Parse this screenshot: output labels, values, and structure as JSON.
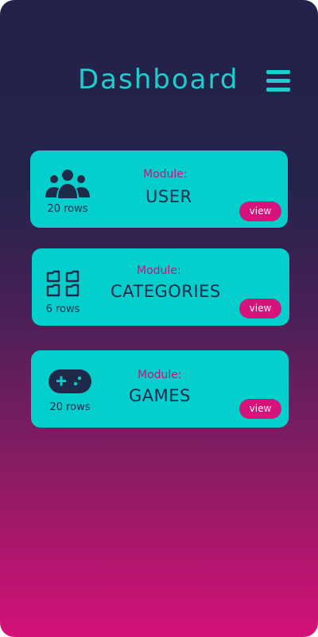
{
  "header": {
    "title": "Dashboard",
    "menu_icon": "hamburger-menu-icon"
  },
  "colors": {
    "title": "#1ccfcf",
    "card_background": "#05cfcd",
    "module_label": "#c2167d",
    "module_name": "#1f2a4a",
    "view_button": "#d7127a",
    "background_top": "#22224a",
    "background_bottom": "#d41178"
  },
  "cards": [
    {
      "icon": "users-icon",
      "rows": "20 rows",
      "label": "Module:",
      "name": "USER",
      "button": "view"
    },
    {
      "icon": "categories-icon",
      "rows": "6 rows",
      "label": "Module:",
      "name": "CATEGORIES",
      "button": "view"
    },
    {
      "icon": "gamepad-icon",
      "rows": "20 rows",
      "label": "Module:",
      "name": "GAMES",
      "button": "view"
    }
  ]
}
